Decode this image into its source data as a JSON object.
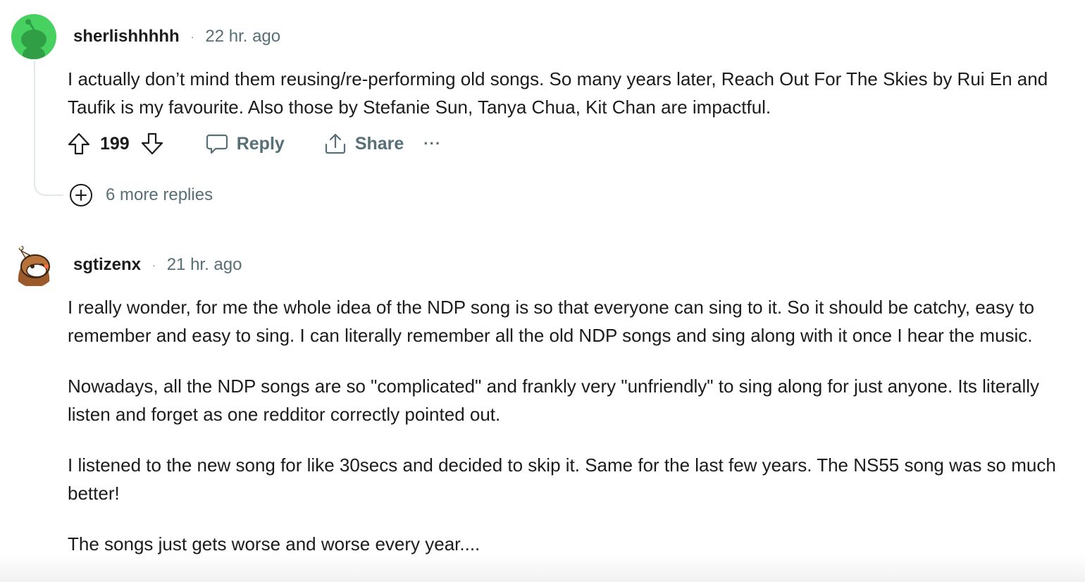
{
  "comments": [
    {
      "username": "sherlishhhhh",
      "separator": "·",
      "time": "22 hr. ago",
      "paragraphs": [
        "I actually don’t mind them reusing/re-performing old songs. So many years later, Reach Out For The Skies by Rui En and Taufik is my favourite. Also those by Stefanie Sun, Tanya Chua, Kit Chan are impactful."
      ],
      "score": "199",
      "reply_label": "Reply",
      "share_label": "Share",
      "more_label": "···",
      "more_replies": "6 more replies",
      "avatar_color": "#46d160"
    },
    {
      "username": "sgtizenx",
      "separator": "·",
      "time": "21 hr. ago",
      "paragraphs": [
        "I really wonder, for me the whole idea of the NDP song is so that everyone can sing to it. So it should be catchy, easy to remember and easy to sing. I can literally remember all the old NDP songs and sing along with it once I hear the music.",
        "Nowadays, all the NDP songs are so \"complicated\" and frankly very \"unfriendly\" to sing along for just anyone. Its literally listen and forget as one redditor correctly pointed out.",
        "I listened to the new song for like 30secs and decided to skip it. Same for the last few years. The NS55 song was so much better!",
        "The songs just gets worse and worse every year...."
      ],
      "avatar_color": "#ffffff"
    }
  ],
  "icons": {
    "upvote": "upvote-icon",
    "downvote": "downvote-icon",
    "reply": "comment-bubble-icon",
    "share": "share-icon",
    "expand": "plus-circle-icon"
  },
  "colors": {
    "text": "#1c1c1c",
    "meta": "#576f76",
    "thread_line": "#e2e7e9"
  }
}
